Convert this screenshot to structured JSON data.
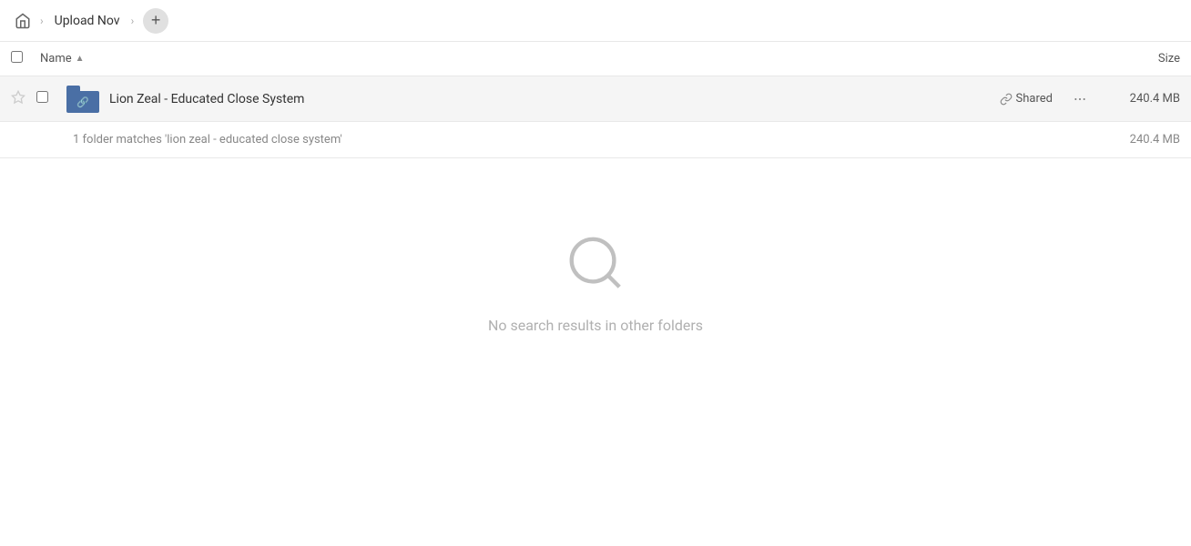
{
  "breadcrumb": {
    "home_label": "Home",
    "separator": "›",
    "folder_label": "Upload Nov",
    "add_button_label": "+"
  },
  "columns": {
    "name_label": "Name",
    "name_sort_indicator": "▲",
    "size_label": "Size"
  },
  "file_row": {
    "name": "Lion Zeal - Educated Close System",
    "shared_label": "Shared",
    "size": "240.4 MB",
    "more_icon": "•••"
  },
  "summary": {
    "text": "1 folder matches 'lion zeal - educated close system'",
    "size": "240.4 MB"
  },
  "empty_state": {
    "icon": "🔍",
    "message": "No search results in other folders"
  },
  "colors": {
    "folder_blue": "#4a6fa5",
    "header_bg": "#ffffff",
    "row_hover_bg": "#f5f5f5",
    "accent": "#4a6fa5"
  }
}
